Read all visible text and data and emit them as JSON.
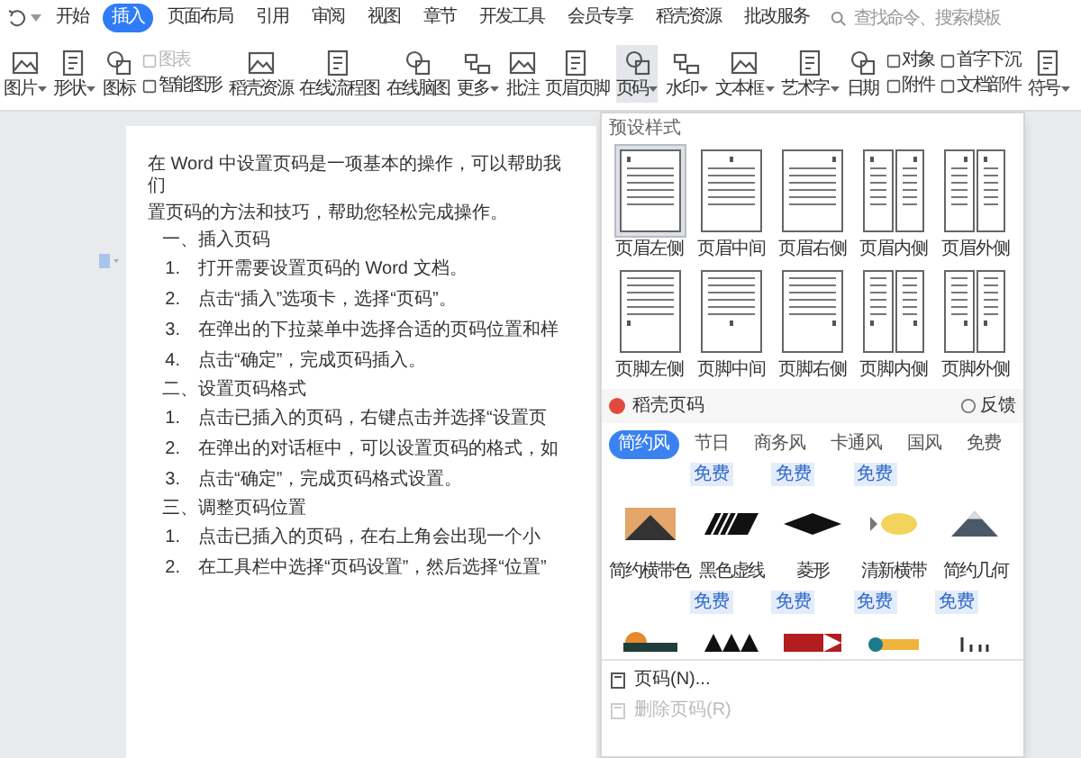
{
  "menu_tabs": [
    {
      "label": "开始",
      "selected": false
    },
    {
      "label": "插入",
      "selected": true
    },
    {
      "label": "页面布局",
      "selected": false
    },
    {
      "label": "引用",
      "selected": false
    },
    {
      "label": "审阅",
      "selected": false
    },
    {
      "label": "视图",
      "selected": false
    },
    {
      "label": "章节",
      "selected": false
    },
    {
      "label": "开发工具",
      "selected": false
    },
    {
      "label": "会员专享",
      "selected": false
    },
    {
      "label": "稻壳资源",
      "selected": false
    },
    {
      "label": "批改服务",
      "selected": false
    }
  ],
  "search": {
    "placeholder": "查找命令、搜索模板"
  },
  "ribbon": [
    {
      "kind": "large",
      "label": "图片",
      "dropdown": true,
      "selected": false
    },
    {
      "kind": "large",
      "label": "形状",
      "dropdown": true,
      "selected": false
    },
    {
      "kind": "large",
      "label": "图标",
      "dropdown": false,
      "selected": false
    },
    {
      "kind": "stack",
      "items": [
        {
          "label": "图表",
          "disabled": true
        },
        {
          "label": "智能图形",
          "disabled": false
        }
      ]
    },
    {
      "kind": "large",
      "label": "稻壳资源",
      "dropdown": false,
      "selected": false
    },
    {
      "kind": "large",
      "label": "在线流程图",
      "dropdown": false,
      "selected": false
    },
    {
      "kind": "large",
      "label": "在线脑图",
      "dropdown": false,
      "selected": false
    },
    {
      "kind": "large",
      "label": "更多",
      "dropdown": true,
      "selected": false
    },
    {
      "kind": "large",
      "label": "批注",
      "dropdown": false,
      "selected": false
    },
    {
      "kind": "large",
      "label": "页眉页脚",
      "dropdown": false,
      "selected": false
    },
    {
      "kind": "large",
      "label": "页码",
      "dropdown": true,
      "selected": true
    },
    {
      "kind": "large",
      "label": "水印",
      "dropdown": true,
      "selected": false
    },
    {
      "kind": "large",
      "label": "文本框",
      "dropdown": true,
      "selected": false
    },
    {
      "kind": "large",
      "label": "艺术字",
      "dropdown": true,
      "selected": false
    },
    {
      "kind": "large",
      "label": "日期",
      "dropdown": false,
      "selected": false
    },
    {
      "kind": "stack",
      "items": [
        {
          "label": "对象",
          "disabled": false
        },
        {
          "label": "附件",
          "disabled": false
        }
      ]
    },
    {
      "kind": "stack",
      "items": [
        {
          "label": "首字下沉",
          "disabled": false
        },
        {
          "label": "文档部件",
          "disabled": false
        }
      ]
    },
    {
      "kind": "large",
      "label": "符号",
      "dropdown": true,
      "selected": false
    }
  ],
  "document": {
    "lines": [
      {
        "kind": "para",
        "text": "在 Word 中设置页码是一项基本的操作，可以帮助我们"
      },
      {
        "kind": "para",
        "text": "置页码的方法和技巧，帮助您轻松完成操作。"
      },
      {
        "kind": "heading",
        "text": "一、插入页码"
      },
      {
        "kind": "item",
        "num": "1.",
        "text": "打开需要设置页码的 Word 文档。"
      },
      {
        "kind": "item",
        "num": "2.",
        "text": "点击“插入”选项卡，选择“页码”。"
      },
      {
        "kind": "item",
        "num": "3.",
        "text": "在弹出的下拉菜单中选择合适的页码位置和样"
      },
      {
        "kind": "item",
        "num": "4.",
        "text": "点击“确定”，完成页码插入。"
      },
      {
        "kind": "heading",
        "text": "二、设置页码格式"
      },
      {
        "kind": "item",
        "num": "1.",
        "text": "点击已插入的页码，右键点击并选择“设置页"
      },
      {
        "kind": "item",
        "num": "2.",
        "text": "在弹出的对话框中，可以设置页码的格式，如"
      },
      {
        "kind": "item",
        "num": "3.",
        "text": "点击“确定”，完成页码格式设置。"
      },
      {
        "kind": "heading",
        "text": "三、调整页码位置"
      },
      {
        "kind": "item",
        "num": "1.",
        "text": "点击已插入的页码，在右上角会出现一个小"
      },
      {
        "kind": "item",
        "num": "2.",
        "text": "在工具栏中选择“页码设置”，然后选择“位置”"
      }
    ]
  },
  "dropdown": {
    "preset_title": "预设样式",
    "presets": [
      {
        "label": "页眉左侧",
        "kind": "topleft",
        "selected": true
      },
      {
        "label": "页眉中间",
        "kind": "topcenter",
        "selected": false
      },
      {
        "label": "页眉右侧",
        "kind": "topright",
        "selected": false
      },
      {
        "label": "页眉内侧",
        "kind": "topinside",
        "selected": false
      },
      {
        "label": "页眉外侧",
        "kind": "topoutside",
        "selected": false
      },
      {
        "label": "页脚左侧",
        "kind": "bottomleft",
        "selected": false
      },
      {
        "label": "页脚中间",
        "kind": "bottomcenter",
        "selected": false
      },
      {
        "label": "页脚右侧",
        "kind": "bottomright",
        "selected": false
      },
      {
        "label": "页脚内侧",
        "kind": "bottominside",
        "selected": false
      },
      {
        "label": "页脚外侧",
        "kind": "bottomoutside",
        "selected": false
      }
    ],
    "section_title": "稻壳页码",
    "feedback": "反馈",
    "style_tabs": [
      {
        "label": "简约风",
        "selected": true
      },
      {
        "label": "节日",
        "selected": false
      },
      {
        "label": "商务风",
        "selected": false
      },
      {
        "label": "卡通风",
        "selected": false
      },
      {
        "label": "国风",
        "selected": false
      },
      {
        "label": "免费",
        "selected": false
      }
    ],
    "templates": [
      {
        "label": "简约横带色",
        "kind": "mountain"
      },
      {
        "label": "黑色虚线",
        "badge": "免费",
        "kind": "stripes"
      },
      {
        "label": "菱形",
        "badge": "免费",
        "kind": "diamond"
      },
      {
        "label": "清新横带",
        "badge": "免费",
        "kind": "fish"
      },
      {
        "label": "简约几何",
        "kind": "peak"
      }
    ],
    "templates_row2": [
      {
        "kind": "sun"
      },
      {
        "badge": "免费",
        "kind": "zigzag"
      },
      {
        "badge": "免费",
        "kind": "flag"
      },
      {
        "badge": "免费",
        "kind": "dot"
      },
      {
        "badge": "免费",
        "kind": "ticks"
      }
    ],
    "actions": [
      {
        "label": "页码(N)...",
        "disabled": false
      },
      {
        "label": "删除页码(R)",
        "disabled": true
      }
    ]
  }
}
